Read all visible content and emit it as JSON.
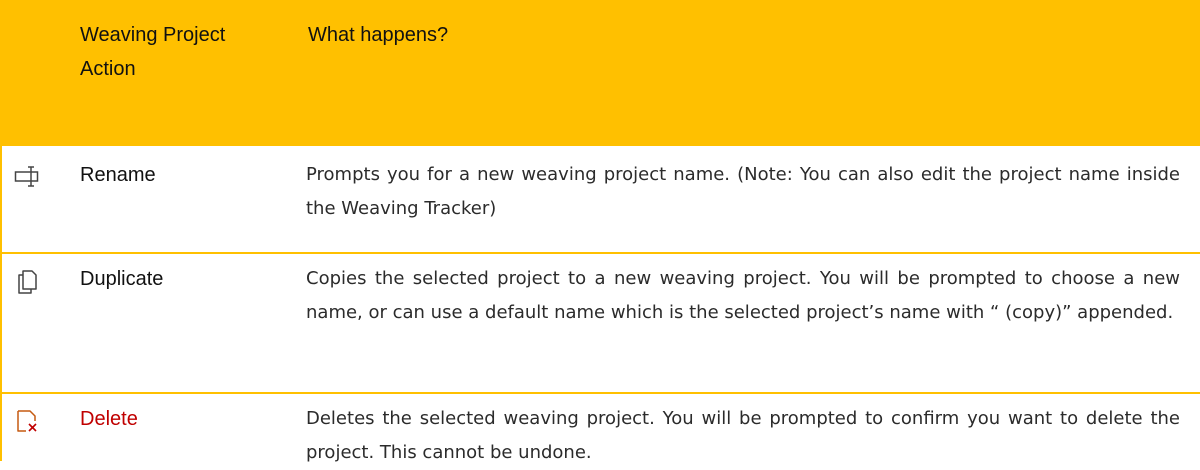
{
  "table": {
    "header": {
      "action": "Weaving Project Action",
      "what": "What happens?"
    },
    "rows": [
      {
        "icon": "rename-icon",
        "action": "Rename",
        "description": "Prompts you for a new weaving project name.  (Note: You can also edit the project name inside the Weaving Tracker)"
      },
      {
        "icon": "duplicate-icon",
        "action": "Duplicate",
        "description": "Copies the selected project to a new weaving project. You will be prompted to choose a new name, or can use a default name which is the selected project’s name with “ (copy)” appended."
      },
      {
        "icon": "delete-icon",
        "action": "Delete",
        "description": "Deletes the selected weaving project. You will be prompted to confirm you want to delete the project. This cannot be undone."
      }
    ]
  },
  "colors": {
    "header_background": "#FFC000",
    "danger_text": "#C00000"
  }
}
